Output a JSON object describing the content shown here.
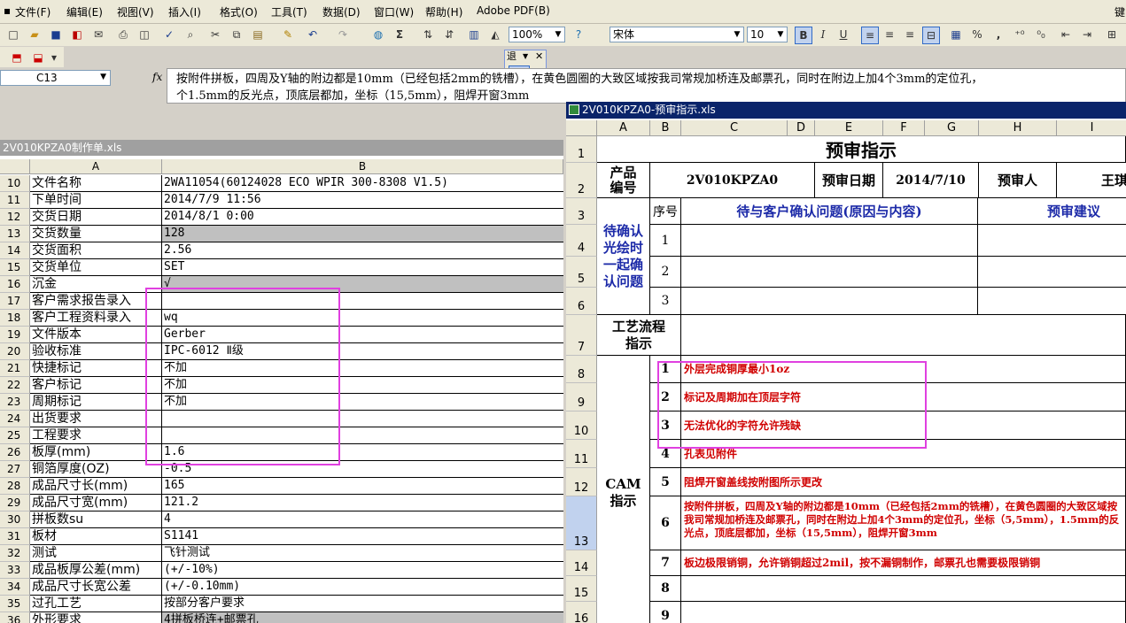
{
  "menu": [
    "文件(F)",
    "编辑(E)",
    "视图(V)",
    "插入(I)",
    "格式(O)",
    "工具(T)",
    "数据(D)",
    "窗口(W)",
    "帮助(H)",
    "Adobe PDF(B)"
  ],
  "menu_right": "键",
  "toolbar": {
    "zoom": "100%",
    "font": "宋体",
    "size": "10",
    "bold": "B",
    "italic": "I",
    "underline": "U",
    "percent": "%",
    "comma": ",",
    "sigma": "Σ"
  },
  "popup": {
    "title": "退"
  },
  "formula": {
    "namebox": "C13",
    "fx": "fx",
    "line1": "按附件拼板，四周及Y轴的附边都是10mm（已经包括2mm的铣槽），在黄色圆圈的大致区域按我司常规加桥连及邮票孔，同时在附边上加4个3mm的定位孔，",
    "line2": "个1.5mm的反光点，顶底层都加，坐标（15,5mm），阻焊开窗3mm"
  },
  "left": {
    "title": "2V010KPZA0制作单.xls",
    "col_a": "A",
    "col_b": "B",
    "rows": [
      {
        "n": "10",
        "a": "文件名称",
        "b": "2WA11054(60124028 ECO WPIR 300-8308 V1.5)"
      },
      {
        "n": "11",
        "a": "下单时间",
        "b": "2014/7/9 11:56"
      },
      {
        "n": "12",
        "a": "交货日期",
        "b": "2014/8/1 0:00"
      },
      {
        "n": "13",
        "a": "交货数量",
        "b": "128"
      },
      {
        "n": "14",
        "a": "交货面积",
        "b": "2.56"
      },
      {
        "n": "15",
        "a": "交货单位",
        "b": "SET"
      },
      {
        "n": "16",
        "a": "沉金",
        "b": "√"
      },
      {
        "n": "17",
        "a": "客户需求报告录入",
        "b": ""
      },
      {
        "n": "18",
        "a": "客户工程资料录入",
        "b": "wq"
      },
      {
        "n": "19",
        "a": "文件版本",
        "b": "Gerber"
      },
      {
        "n": "20",
        "a": "验收标准",
        "b": "IPC-6012 Ⅱ级"
      },
      {
        "n": "21",
        "a": "快捷标记",
        "b": "不加"
      },
      {
        "n": "22",
        "a": "客户标记",
        "b": "不加"
      },
      {
        "n": "23",
        "a": "周期标记",
        "b": "不加"
      },
      {
        "n": "24",
        "a": "出货要求",
        "b": ""
      },
      {
        "n": "25",
        "a": "工程要求",
        "b": ""
      },
      {
        "n": "26",
        "a": "板厚(mm)",
        "b": "1.6"
      },
      {
        "n": "27",
        "a": "铜箔厚度(OZ)",
        "b": "-0.5"
      },
      {
        "n": "28",
        "a": "成品尺寸长(mm)",
        "b": "165"
      },
      {
        "n": "29",
        "a": "成品尺寸宽(mm)",
        "b": "121.2"
      },
      {
        "n": "30",
        "a": "拼板数su",
        "b": "4"
      },
      {
        "n": "31",
        "a": "板材",
        "b": "S1141"
      },
      {
        "n": "32",
        "a": "测试",
        "b": "飞针测试"
      },
      {
        "n": "33",
        "a": "成品板厚公差(mm)",
        "b": "(+/-10%)"
      },
      {
        "n": "34",
        "a": "成品尺寸长宽公差",
        "b": "(+/-0.10mm)"
      },
      {
        "n": "35",
        "a": "过孔工艺",
        "b": "按部分客户要求"
      },
      {
        "n": "36",
        "a": "外形要求",
        "b": "4拼板桥连+邮票孔"
      }
    ]
  },
  "right": {
    "title": "2V010KPZA0-预审指示.xls",
    "cols": [
      "A",
      "B",
      "C",
      "D",
      "E",
      "F",
      "G",
      "H",
      "I"
    ],
    "rownums": [
      "1",
      "2",
      "3",
      "4",
      "5",
      "6",
      "7",
      "8",
      "9",
      "10",
      "11",
      "12",
      "13",
      "14",
      "15",
      "16"
    ],
    "sheet_title": "预审指示",
    "product_no_label": "产品编号",
    "product_no": "2V010KPZA0",
    "review_date_label": "预审日期",
    "review_date": "2014/7/10",
    "reviewer_label": "预审人",
    "reviewer": "王琪",
    "seq_label": "序号",
    "issues_label": "待与客户确认问题(原因与内容)",
    "advice_label": "预审建议",
    "confirm_label": "待确认光绘时一起确认问题",
    "confirm_seq": [
      "1",
      "2",
      "3"
    ],
    "process_label": "工艺流程指示",
    "cam_label": "CAM指示",
    "cam_items": [
      {
        "n": "1",
        "t": "外层完成铜厚最小1oz"
      },
      {
        "n": "2",
        "t": "标记及周期加在顶层字符"
      },
      {
        "n": "3",
        "t": "无法优化的字符允许残缺"
      },
      {
        "n": "4",
        "t": "孔表见附件"
      },
      {
        "n": "5",
        "t": "阻焊开窗盖线按附图所示更改"
      },
      {
        "n": "6",
        "t": "按附件拼板，四周及Y轴的附边都是10mm（已经包括2mm的铣槽），在黄色圆圈的大致区域按我司常规加桥连及邮票孔，同时在附边上加4个3mm的定位孔，坐标（5,5mm），1.5mm的反光点，顶底层都加，坐标（15,5mm），阻焊开窗3mm"
      },
      {
        "n": "7",
        "t": "板边极限销铜，允许销铜超过2mil，按不漏铜制作，邮票孔也需要极限销铜"
      },
      {
        "n": "8",
        "t": ""
      },
      {
        "n": "9",
        "t": ""
      }
    ]
  },
  "colors": {
    "accent_highlight": "#e040e0",
    "cam_text": "#d00000",
    "label_blue": "#1c2aa8",
    "title_bar": "#0a246a"
  }
}
